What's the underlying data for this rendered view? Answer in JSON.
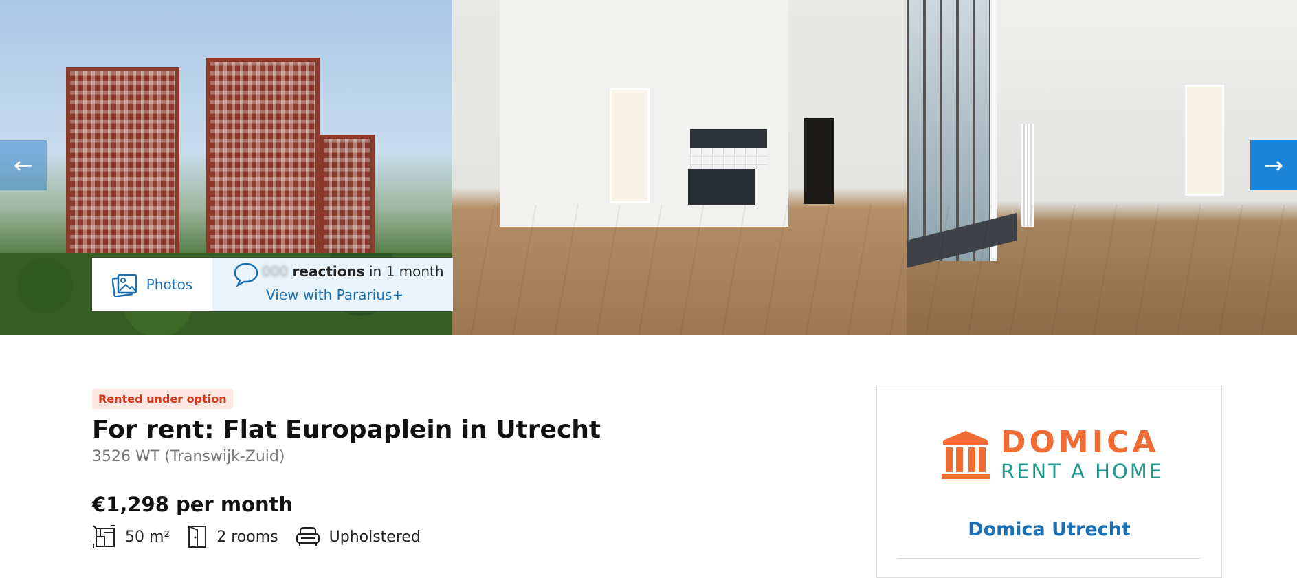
{
  "gallery": {
    "prev_arrow": "←",
    "next_arrow": "→",
    "photos_label": "Photos",
    "reactions_count": "000",
    "reactions_label": "reactions",
    "reactions_period": "in 1 month",
    "pararius_link": "View with Pararius+"
  },
  "listing": {
    "status": "Rented under option",
    "title": "For rent: Flat Europaplein in Utrecht",
    "address": "3526 WT (Transwijk-Zuid)",
    "price": "€1,298 per month",
    "features": {
      "area": "50 m²",
      "rooms": "2 rooms",
      "furnishing": "Upholstered"
    }
  },
  "agent": {
    "logo_top": "DOMICA",
    "logo_bottom": "RENT A HOME",
    "name": "Domica Utrecht"
  },
  "colors": {
    "accent_blue": "#1b6fb3",
    "nav_blue": "#1b84d6",
    "status_red": "#d0381a",
    "logo_orange": "#ef6c35",
    "logo_teal": "#1f9a8a"
  }
}
